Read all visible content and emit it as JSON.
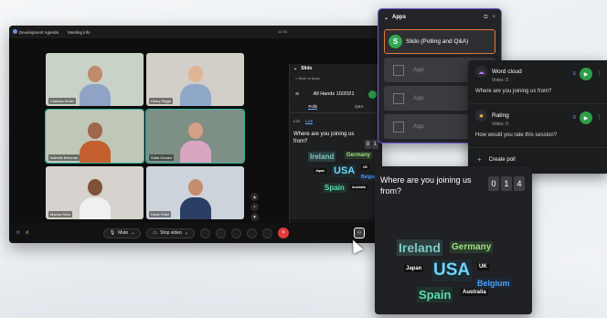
{
  "window": {
    "title": "Development Agenda",
    "subtitle": "Meeting info",
    "time": "12:40"
  },
  "participants": [
    {
      "name": "Clarissa Smith",
      "bg": "#c9d2c6",
      "skin": "#c08a6b",
      "shirt": "#8ea3c6"
    },
    {
      "name": "Henry Riggs",
      "bg": "#d2cfc8",
      "skin": "#e0b596",
      "shirt": "#8fa7c8"
    },
    {
      "name": "Isabelle Brennan",
      "bg": "#bfc7b8",
      "skin": "#a0674a",
      "shirt": "#c4602f"
    },
    {
      "name": "Sofia Gomez",
      "bg": "#7e8f86",
      "skin": "#d3a083",
      "shirt": "#d9a6c2"
    },
    {
      "name": "Marisa Sims",
      "bg": "#d6d2cd",
      "skin": "#7f5238",
      "shirt": "#f0f0f0"
    },
    {
      "name": "Umar Patel",
      "bg": "#cdd3da",
      "skin": "#c48d6e",
      "shirt": "#2a3e66"
    }
  ],
  "controls": {
    "mute": "Mute",
    "stop_video": "Stop video",
    "end": "×"
  },
  "slido_panel": {
    "header": "Slido",
    "back": "< Back to Apps",
    "event": "All Hands 10/2021",
    "tabs": [
      "Polls",
      "Q&A"
    ],
    "subtabs": [
      "List",
      "Live"
    ],
    "question": "Where are you joining us from?",
    "count": [
      "0",
      "1"
    ]
  },
  "apps": {
    "title": "Apps",
    "items": [
      "Slido (Polling and Q&A)",
      "App",
      "App",
      "App"
    ]
  },
  "polls": [
    {
      "title": "Word cloud",
      "votes": "Votes: 0",
      "question": "Where are you joining us from?",
      "icon": "word-cloud-icon"
    },
    {
      "title": "Rating",
      "votes": "Votes: 0",
      "question": "How would you rate this session?",
      "icon": "star-icon"
    }
  ],
  "create_poll": "Create poll",
  "cloud": {
    "question": "Where are you joining us from?",
    "count": [
      "0",
      "1",
      "4"
    ],
    "words": [
      {
        "text": "Ireland",
        "color": "#7ec9c4",
        "bg": "#2c3e3f"
      },
      {
        "text": "Germany",
        "color": "#9ee07f",
        "bg": "#2a3a2c"
      },
      {
        "text": "Japan",
        "color": "#ffffff",
        "bg": "#111"
      },
      {
        "text": "USA",
        "color": "#6ad8ff",
        "bg": "#1e2a2f"
      },
      {
        "text": "UK",
        "color": "#ffffff",
        "bg": "#111"
      },
      {
        "text": "Belgium",
        "color": "#4aa0ff",
        "bg": "#1d2633"
      },
      {
        "text": "Spain",
        "color": "#5ddcae",
        "bg": "#1f332c"
      },
      {
        "text": "Australia",
        "color": "#ffffff",
        "bg": "#111"
      }
    ]
  }
}
